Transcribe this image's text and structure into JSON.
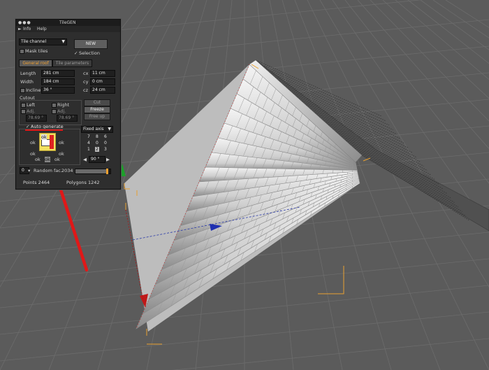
{
  "window": {
    "title": "TileGEN",
    "title_prefix": "●●●"
  },
  "menu": {
    "items": [
      "Info",
      "Help"
    ]
  },
  "top": {
    "channel_select": "Tile channel",
    "new_label": "NEW",
    "mask_tiles": "Mask tiles",
    "selection": "Selection"
  },
  "tabs": {
    "general": "General roof",
    "tile": "Tile parameters"
  },
  "general": {
    "length_label": "Length",
    "length_value": "281 cm",
    "width_label": "Width",
    "width_value": "184 cm",
    "incline_label": "Incline",
    "incline_value": "36 °",
    "cx_label": "cx",
    "cx_value": "11 cm",
    "cy_label": "cy",
    "cy_value": "0 cm",
    "cz_label": "cz",
    "cz_value": "24 cm"
  },
  "cutout": {
    "group_label": "Cutout",
    "left_label": "Left",
    "right_label": "Right",
    "adj_label": "Adj.",
    "left_value": "78.69 °",
    "right_value": "78.69 °",
    "cut_label": "Cut",
    "freeze_label": "Freeze",
    "free_up_label": "Free up"
  },
  "auto": {
    "label": "Auto generate",
    "ok": "ok",
    "fixed_axis": "Fixed axis",
    "grid": [
      "7",
      "8",
      "6",
      "4",
      "0",
      "0",
      "1",
      "2",
      "3"
    ],
    "angle": "90 °"
  },
  "random": {
    "value": "0",
    "label": "Random fac.",
    "seed": "2034"
  },
  "status": {
    "points": "Points 2464",
    "polygons": "Polygons 1242"
  },
  "colors": {
    "accent_orange": "#e8a030",
    "annotation_red": "#e01818",
    "panel_bg": "#2e2e2e"
  }
}
